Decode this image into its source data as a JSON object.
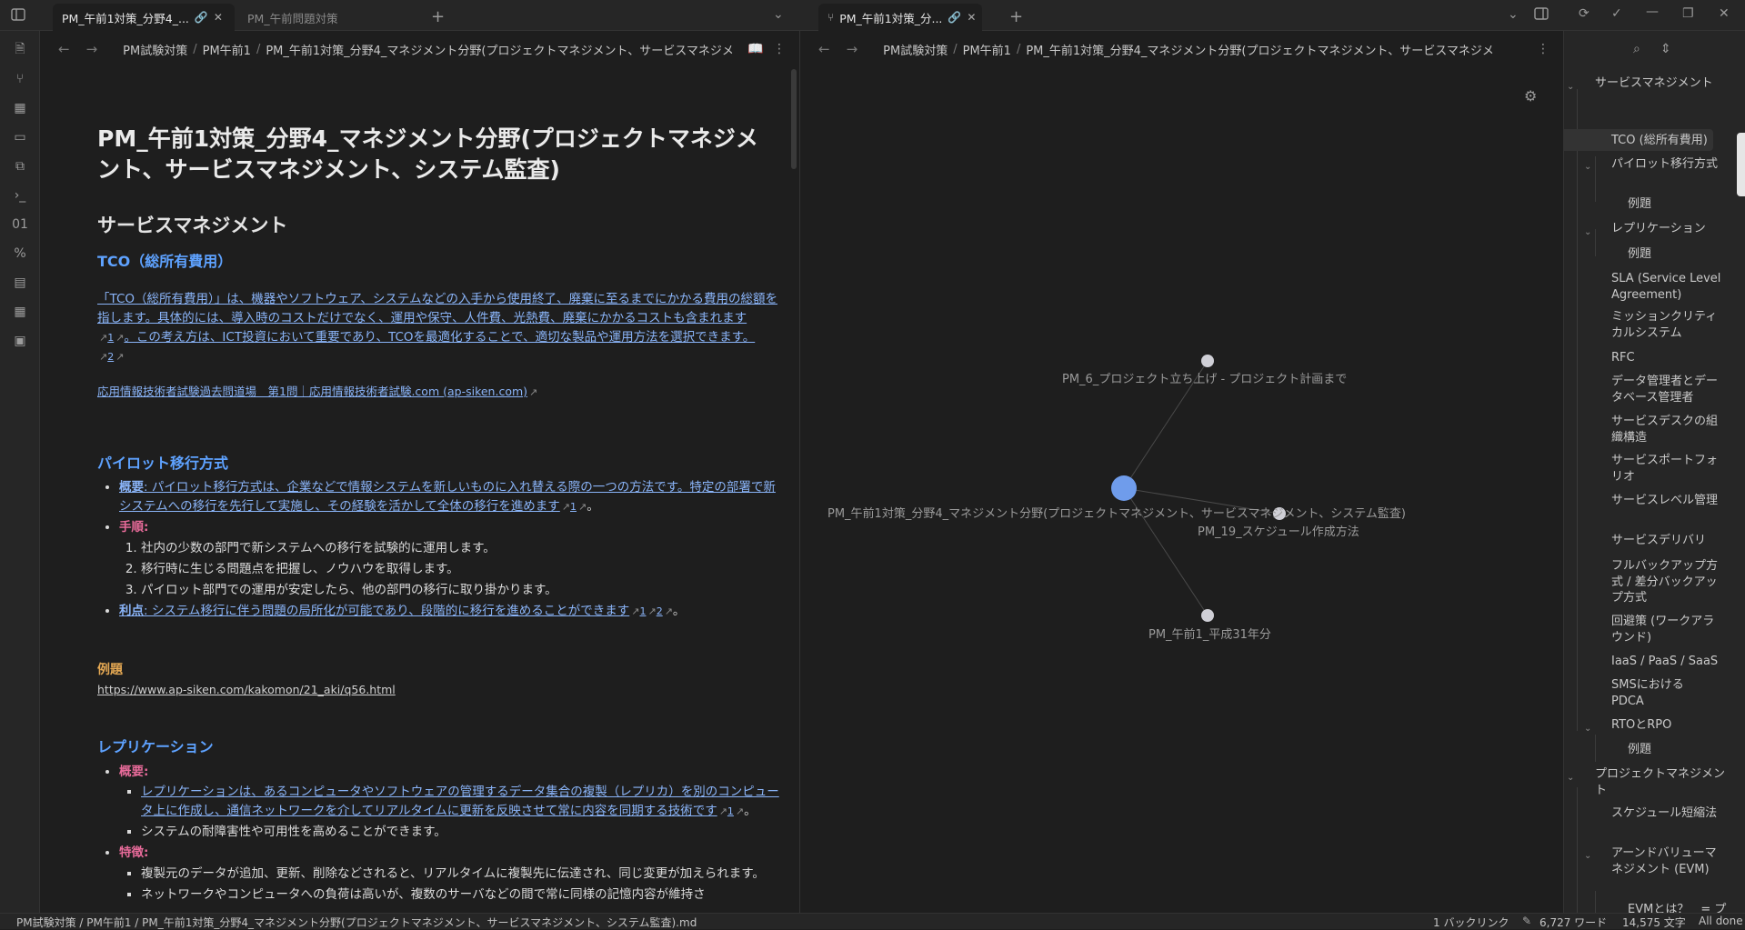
{
  "tabs": {
    "left_active": "PM_午前1対策_分野4_...",
    "left_inactive": "PM_午前問題対策",
    "right_active": "PM_午前1対策_分..."
  },
  "breadcrumb": {
    "folder1": "PM試験対策",
    "folder2": "PM午前1",
    "file": "PM_午前1対策_分野4_マネジメント分野(プロジェクトマネジメント、サービスマネジメ",
    "right_file": "PM_午前1対策_分野4_マネジメント分野(プロジェクトマネジメント、サービスマネジメ"
  },
  "doc": {
    "title": "PM_午前1対策_分野4_マネジメント分野(プロジェクトマネジメント、サービスマネジメント、システム監査)",
    "section1": "サービスマネジメント",
    "tco_heading": "TCO（総所有費用）",
    "tco_para": "「TCO（総所有費用）」は、機器やソフトウェア、システムなどの入手から使用終了、廃棄に至るまでにかかる費用の総額を指します。具体的には、導入時のコストだけでなく、運用や保守、人件費、光熱費、廃棄にかかるコストも含まれます",
    "tco_para2": "。この考え方は、ICT投資において重要であり、TCOを最適化することで、適切な製品や運用方法を選択できます。",
    "tco_link": "応用情報技術者試験過去問道場　第1問｜応用情報技術者試験.com (ap-siken.com)",
    "pilot_heading": "パイロット移行方式",
    "pilot_overview_label": "概要",
    "pilot_overview": ": パイロット移行方式は、企業などで情報システムを新しいものに入れ替える際の一つの方法です。特定の部署で新システムへの移行を先行して実施し、その経験を活かして全体の移行を進めます",
    "pilot_steps_label": "手順",
    "pilot_steps": [
      "社内の少数の部門で新システムへの移行を試験的に運用します。",
      "移行時に生じる問題点を把握し、ノウハウを取得します。",
      "パイロット部門での運用が安定したら、他の部門の移行に取り掛かります。"
    ],
    "pilot_merit_label": "利点",
    "pilot_merit": ": システム移行に伴う問題の局所化が可能であり、段階的に移行を進めることができます",
    "example_heading": "例題",
    "example_url": "https://www.ap-siken.com/kakomon/21_aki/q56.html",
    "repl_heading": "レプリケーション",
    "repl_overview_label": "概要",
    "repl_overview": "レプリケーションは、あるコンピュータやソフトウェアの管理するデータ集合の複製（レプリカ）を別のコンピュータ上に作成し、通信ネットワークを介してリアルタイムに更新を反映させて常に内容を同期する技術です",
    "repl_overview2": "システムの耐障害性や可用性を高めることができます。",
    "repl_feature_label": "特徴",
    "repl_feature1": "複製元のデータが追加、更新、削除などされると、リアルタイムに複製先に伝達され、同じ変更が加えられます。",
    "repl_feature2": "ネットワークやコンピュータへの負荷は高いが、複数のサーバなどの間で常に同様の記憶内容が維持さ",
    "refs": {
      "r1": "1",
      "r2": "2"
    }
  },
  "graph": {
    "node_center": "PM_午前1対策_分野4_マネジメント分野(プロジェクトマネジメント、サービスマネジメント、システム監査)",
    "node_top": "PM_6_プロジェクト立ち上げ - プロジェクト計画まで",
    "node_right": "PM_19_スケジュール作成方法",
    "node_bottom": "PM_午前1_平成31年分",
    "accent_color": "#6f9ceb"
  },
  "outline": {
    "items": [
      "サービスマネジメント",
      "TCO (総所有費用)",
      "パイロット移行方式",
      "例題",
      "レプリケーション",
      "例題",
      "SLA (Service Level Agreement)",
      "ミッションクリティカルシステム",
      "RFC",
      "データ管理者とデータベース管理者",
      "サービスデスクの組織構造",
      "サービスポートフォリオ",
      "サービスレベル管理",
      "サービスデリバリ",
      "フルバックアップ方式 / 差分バックアップ方式",
      "回避策 (ワークアラウンド)",
      "IaaS / PaaS / SaaS",
      "SMSにおけるPDCA",
      "RTOとRPO",
      "例題",
      "プロジェクトマネジメント",
      "スケジュール短縮法",
      "アーンドバリューマネジメント (EVM)",
      "EVMとは？　= プロジェクトの進捗状況の把握"
    ]
  },
  "status": {
    "path": "PM試験対策 / PM午前1 / PM_午前1対策_分野4_マネジメント分野(プロジェクトマネジメント、サービスマネジメント、システム監査).md",
    "backlinks": "1 バックリンク",
    "words": "6,727 ワード",
    "chars": "14,575 文字",
    "sync": "All done"
  }
}
